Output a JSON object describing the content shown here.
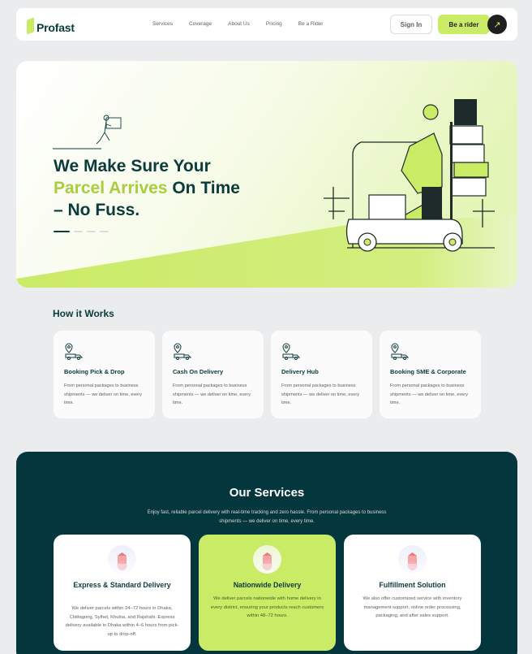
{
  "brand": {
    "name": "Profast",
    "accent": "#caeb66",
    "dark": "#03373d"
  },
  "nav": {
    "links": [
      "Services",
      "Coverage",
      "About Us",
      "Pricing",
      "Be a Rider"
    ],
    "sign_in": "Sign In",
    "be_rider": "Be a rider",
    "arrow_icon": "arrow-up-right-icon"
  },
  "hero": {
    "line1": "We Make Sure Your",
    "line2_accent": "Parcel Arrives",
    "line2_rest": " On Time",
    "line3": "– No Fuss.",
    "slides": 4,
    "active_slide": 1
  },
  "how": {
    "title": "How it Works",
    "cards": [
      {
        "title": "Booking Pick & Drop",
        "desc": "From personal packages to business shipments — we deliver on time, every time.",
        "icon": "delivery-truck-pin-icon"
      },
      {
        "title": "Cash On Delivery",
        "desc": "From personal packages to business shipments — we deliver on time, every time.",
        "icon": "delivery-truck-pin-icon"
      },
      {
        "title": "Delivery Hub",
        "desc": "From personal packages to business shipments — we deliver on time, every time.",
        "icon": "delivery-truck-pin-icon"
      },
      {
        "title": "Booking SME & Corporate",
        "desc": "From personal packages to business shipments — we deliver on time, every time.",
        "icon": "delivery-truck-pin-icon"
      }
    ]
  },
  "services": {
    "title": "Our Services",
    "subtitle": "Enjoy fast, reliable parcel delivery with real-time tracking and zero hassle. From personal packages to business shipments — we deliver on time, every time.",
    "cards": [
      {
        "title": "Express  & Standard Delivery",
        "desc": "We deliver parcels within 24–72 hours in Dhaka, Chittagong, Sylhet, Khulna, and Rajshahi. Express delivery available in Dhaka within 4–6 hours from pick-up to drop-off.",
        "icon": "service-box-icon"
      },
      {
        "title": "Nationwide Delivery",
        "desc": "We deliver parcels nationwide with home delivery in every district, ensuring your products reach customers within 48–72 hours.",
        "icon": "service-box-icon"
      },
      {
        "title": "Fulfillment Solution",
        "desc": "We also offer customized service with inventory management support, online order processing, packaging, and after sales support.",
        "icon": "service-box-icon"
      }
    ]
  }
}
